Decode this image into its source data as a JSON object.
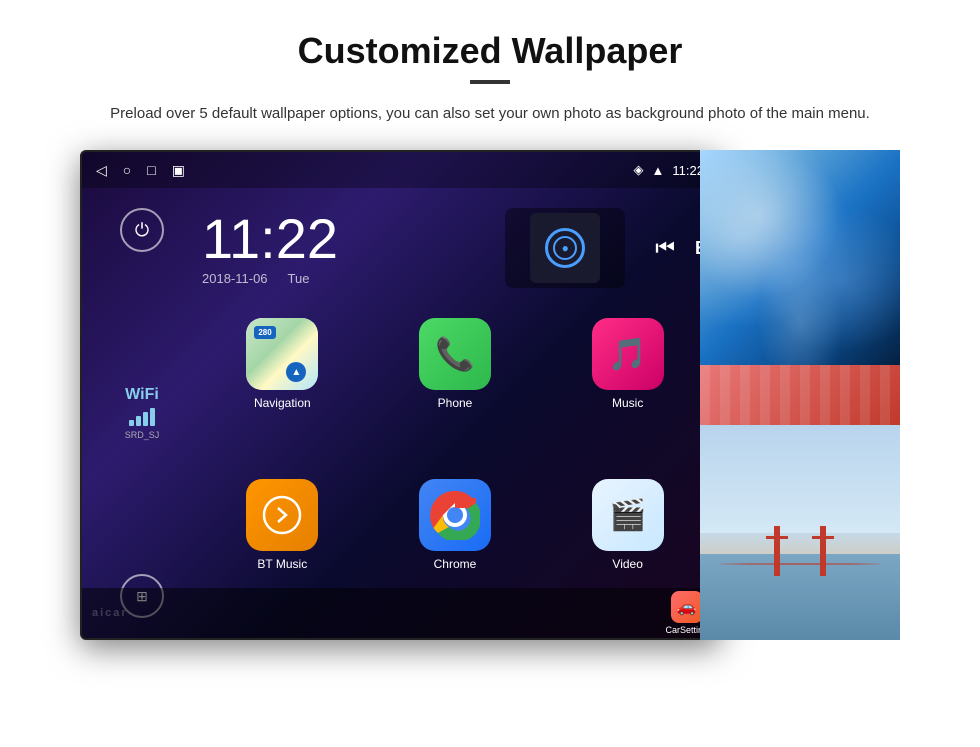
{
  "header": {
    "title": "Customized Wallpaper",
    "subtitle": "Preload over 5 default wallpaper options, you can also set your own photo as background photo of the main menu."
  },
  "android": {
    "statusBar": {
      "time": "11:22",
      "icons": [
        "◁",
        "○",
        "□",
        "▣"
      ]
    },
    "clock": {
      "time": "11:22",
      "date": "2018-11-06",
      "day": "Tue"
    },
    "wifi": {
      "label": "WiFi",
      "ssid": "SRD_SJ"
    },
    "apps": [
      {
        "name": "Navigation",
        "icon": "nav"
      },
      {
        "name": "Phone",
        "icon": "phone"
      },
      {
        "name": "Music",
        "icon": "music"
      },
      {
        "name": "BT Music",
        "icon": "btmusic"
      },
      {
        "name": "Chrome",
        "icon": "chrome"
      },
      {
        "name": "Video",
        "icon": "video"
      }
    ],
    "bottomApps": [
      {
        "name": "CarSetting"
      }
    ]
  },
  "watermark": "aicar"
}
